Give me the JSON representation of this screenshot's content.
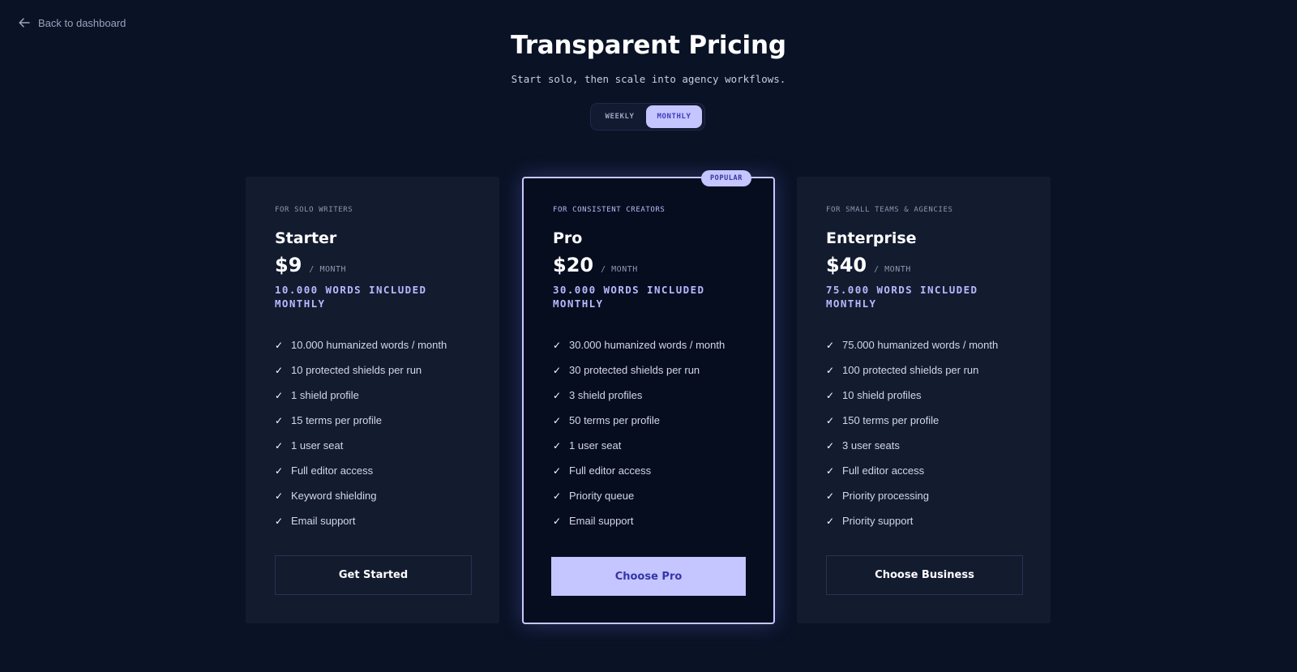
{
  "nav": {
    "back_label": "Back to dashboard"
  },
  "header": {
    "title": "Transparent Pricing",
    "subtitle": "Start solo, then scale into agency workflows."
  },
  "billing_toggle": {
    "options": [
      "WEEKLY",
      "MONTHLY"
    ],
    "selected": "MONTHLY"
  },
  "colors": {
    "background": "#0a1226",
    "card": "#131b2f",
    "accent": "#c5c5ff",
    "accent_text": "#b7b9ff"
  },
  "plans": [
    {
      "tagline": "FOR SOLO WRITERS",
      "name": "Starter",
      "price": "$9",
      "period": "/ MONTH",
      "words": "10.000 WORDS INCLUDED MONTHLY",
      "features": [
        "10.000 humanized words / month",
        "10 protected shields per run",
        "1 shield profile",
        "15 terms per profile",
        "1 user seat",
        "Full editor access",
        "Keyword shielding",
        "Email support"
      ],
      "cta": "Get Started"
    },
    {
      "badge": "POPULAR",
      "tagline": "FOR CONSISTENT CREATORS",
      "name": "Pro",
      "price": "$20",
      "period": "/ MONTH",
      "words": "30.000 WORDS INCLUDED MONTHLY",
      "features": [
        "30.000 humanized words / month",
        "30 protected shields per run",
        "3 shield profiles",
        "50 terms per profile",
        "1 user seat",
        "Full editor access",
        "Priority queue",
        "Email support"
      ],
      "cta": "Choose Pro"
    },
    {
      "tagline": "FOR SMALL TEAMS & AGENCIES",
      "name": "Enterprise",
      "price": "$40",
      "period": "/ MONTH",
      "words": "75.000 WORDS INCLUDED MONTHLY",
      "features": [
        "75.000 humanized words / month",
        "100 protected shields per run",
        "10 shield profiles",
        "150 terms per profile",
        "3 user seats",
        "Full editor access",
        "Priority processing",
        "Priority support"
      ],
      "cta": "Choose Business"
    }
  ],
  "check_glyph": "✓"
}
